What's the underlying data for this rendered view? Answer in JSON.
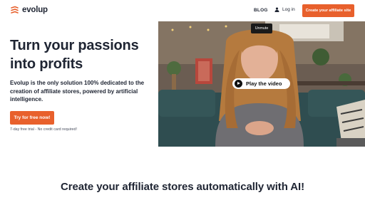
{
  "header": {
    "brand": "evolup",
    "logo_icon": "evolup-logo-icon",
    "nav_blog": "BLOG",
    "nav_login": "Log in",
    "login_icon": "user-icon",
    "cta": "Create your affiliate site"
  },
  "hero": {
    "title": "Turn your passions into profits",
    "description": "Evolup is the only solution 100% dedicated to the creation of affiliate stores, powered by artificial intelligence.",
    "cta": "Try for free now!",
    "trial_note": "7-day free trial - No credit card required!"
  },
  "video": {
    "unmute": "Unmute",
    "play_label": "Play the video",
    "play_icon": "play-icon"
  },
  "section": {
    "title": "Create your affiliate stores automatically with AI!"
  },
  "colors": {
    "accent": "#e8602c",
    "text": "#1f2533"
  }
}
